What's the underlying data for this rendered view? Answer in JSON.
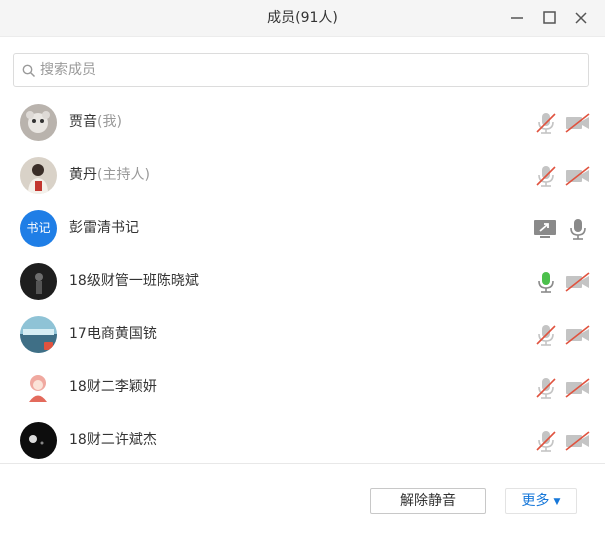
{
  "window": {
    "title": "成员(91人)"
  },
  "search": {
    "placeholder": "搜索成员"
  },
  "members": [
    {
      "name": "贾音",
      "role": "(我)"
    },
    {
      "name": "黄丹",
      "role": "(主持人)"
    },
    {
      "name": "彭雷清书记",
      "role": "",
      "avatar_text": "书记"
    },
    {
      "name": "18级财管一班陈晓斌",
      "role": ""
    },
    {
      "name": "17电商黄国铳",
      "role": ""
    },
    {
      "name": "18财二李颖妍",
      "role": ""
    },
    {
      "name": "18财二许斌杰",
      "role": ""
    }
  ],
  "footer": {
    "unmute_all": "解除静音",
    "more": "更多"
  },
  "colors": {
    "accent": "#1677d9",
    "muted_red": "#e0533f",
    "active_mic": "#4cc04c",
    "avatar_blue": "#1f7ee6"
  }
}
